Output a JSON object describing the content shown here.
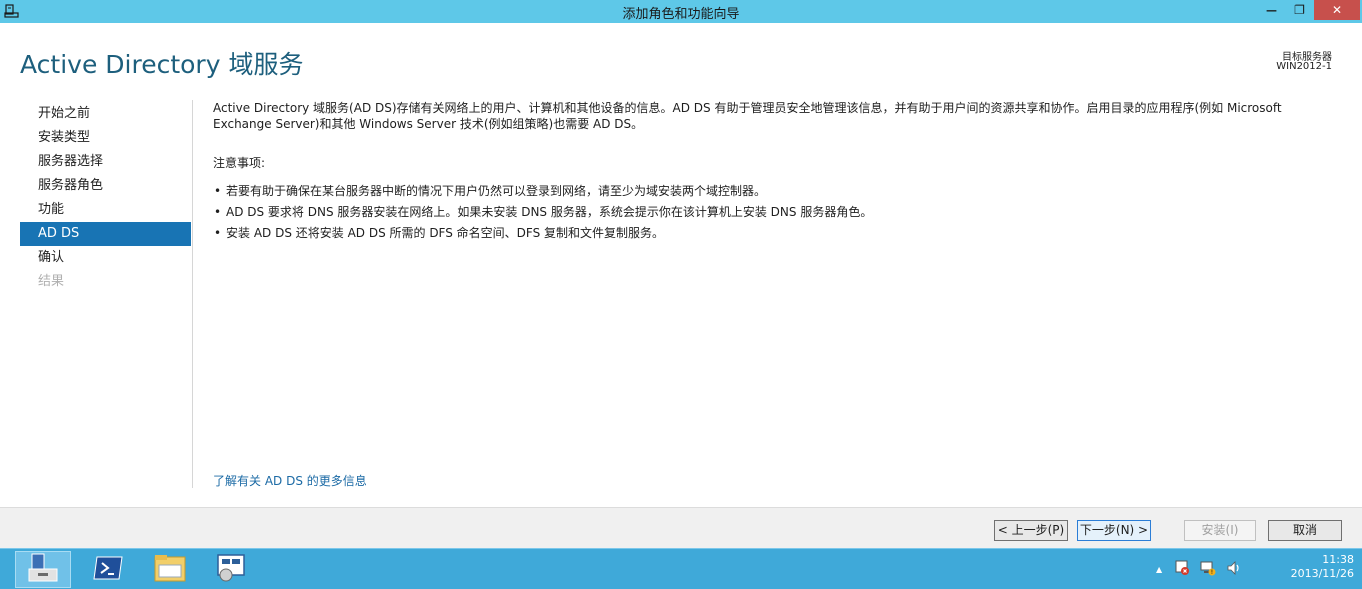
{
  "window": {
    "title": "添加角色和功能向导",
    "min_glyph": "—",
    "max_glyph": "❐",
    "close_glyph": "✕"
  },
  "header": {
    "title": "Active Directory 域服务",
    "target_label": "目标服务器",
    "target_value": "WIN2012-1"
  },
  "nav": {
    "items": [
      {
        "label": "开始之前",
        "state": "normal"
      },
      {
        "label": "安装类型",
        "state": "normal"
      },
      {
        "label": "服务器选择",
        "state": "normal"
      },
      {
        "label": "服务器角色",
        "state": "normal"
      },
      {
        "label": "功能",
        "state": "normal"
      },
      {
        "label": "AD DS",
        "state": "selected"
      },
      {
        "label": "确认",
        "state": "normal"
      },
      {
        "label": "结果",
        "state": "disabled"
      }
    ]
  },
  "content": {
    "intro": "Active Directory 域服务(AD DS)存储有关网络上的用户、计算机和其他设备的信息。AD DS 有助于管理员安全地管理该信息，并有助于用户间的资源共享和协作。启用目录的应用程序(例如 Microsoft Exchange Server)和其他 Windows Server 技术(例如组策略)也需要 AD DS。",
    "notes_title": "注意事项:",
    "bullet": "•",
    "notes": [
      "若要有助于确保在某台服务器中断的情况下用户仍然可以登录到网络，请至少为域安装两个域控制器。",
      "AD DS 要求将 DNS 服务器安装在网络上。如果未安装 DNS 服务器，系统会提示你在该计算机上安装 DNS 服务器角色。",
      "安装 AD DS 还将安装 AD DS 所需的 DFS 命名空间、DFS 复制和文件复制服务。"
    ],
    "more_link": "了解有关 AD DS 的更多信息"
  },
  "buttons": {
    "prev": "< 上一步(P)",
    "next": "下一步(N) >",
    "install": "安装(I)",
    "cancel": "取消"
  },
  "taskbar": {
    "tray_arrow": "▲",
    "time": "11:38",
    "date": "2013/11/26"
  },
  "colors": {
    "titlebar": "#5ec8e8",
    "accent": "#1874b4",
    "title_text": "#1d5f7d",
    "link": "#1b6aa5",
    "taskbar": "#3fa9d9",
    "close": "#c7504c"
  }
}
